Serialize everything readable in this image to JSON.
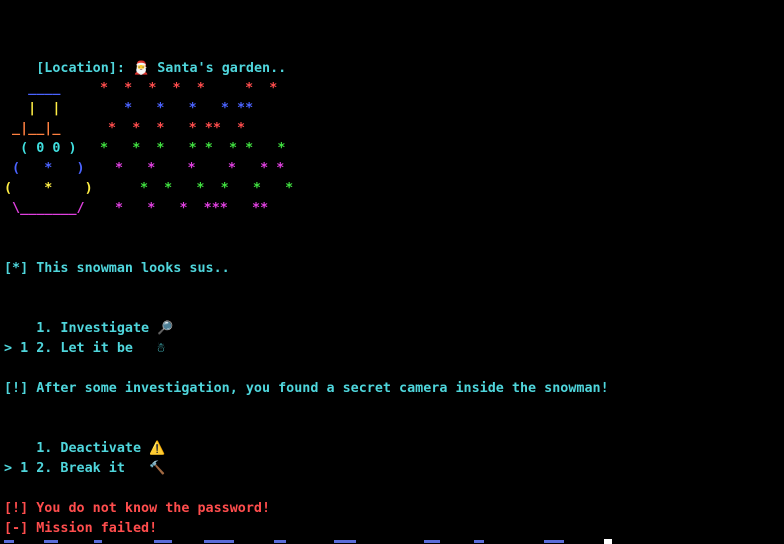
{
  "location": {
    "prefix": "[Location]:",
    "emoji": "🎅",
    "name": "Santa's garden.."
  },
  "ascii_art": {
    "snowman": [
      "   ____",
      "   |  |",
      " _|__|_",
      "  ( 0 0 )",
      " (   *   )",
      "(    *    )",
      " \\_______/"
    ],
    "stars": [
      "*  *  *  *  *     *  *",
      "   *   *   *   * **",
      " *  *  *   * **  *",
      "*   *  *   * *  * *   *",
      "*   *    *    *   * *",
      "*  *   *  *   *   *",
      "*   *   *  ***   **"
    ]
  },
  "messages": {
    "snowman_sus": "[*] This snowman looks sus..",
    "found_camera": "[!] After some investigation, you found a secret camera inside the snowman!",
    "no_password": "[!] You do not know the password!",
    "mission_failed": "[-] Mission failed!"
  },
  "menu1": {
    "option1": "1. Investigate",
    "option1_icon": "magnifying-glass-icon",
    "option1_emoji": "🔎",
    "option2": "2. Let it be",
    "option2_icon": "snowman-icon",
    "option2_emoji": "☃",
    "prompt": "> 1"
  },
  "menu2": {
    "option1": "1. Deactivate",
    "option1_icon": "warning-icon",
    "option1_emoji": "⚠️",
    "option2": "2. Break it",
    "option2_icon": "hammer-icon",
    "option2_emoji": "🔨",
    "prompt": "> 1"
  },
  "colors": {
    "text": "#4fd6dc",
    "error": "#ff4d4d",
    "background": "#000000"
  }
}
